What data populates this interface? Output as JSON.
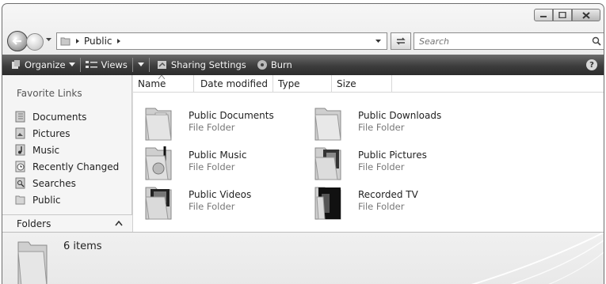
{
  "address": {
    "crumbs": [
      "Public"
    ],
    "search_placeholder": "Search"
  },
  "toolbar": {
    "organize": "Organize",
    "views": "Views",
    "sharing": "Sharing Settings",
    "burn": "Burn",
    "help": "?"
  },
  "nav": {
    "heading": "Favorite Links",
    "items": [
      {
        "label": "Documents",
        "icon": "documents-icon"
      },
      {
        "label": "Pictures",
        "icon": "pictures-icon"
      },
      {
        "label": "Music",
        "icon": "music-icon"
      },
      {
        "label": "Recently Changed",
        "icon": "recently-changed-icon"
      },
      {
        "label": "Searches",
        "icon": "searches-icon"
      },
      {
        "label": "Public",
        "icon": "public-folder-icon"
      }
    ],
    "folders_label": "Folders"
  },
  "columns": [
    "Name",
    "Date modified",
    "Type",
    "Size"
  ],
  "items": [
    {
      "name": "Public Documents",
      "type": "File Folder",
      "icon": "documents-folder-icon"
    },
    {
      "name": "Public Downloads",
      "type": "File Folder",
      "icon": "downloads-folder-icon"
    },
    {
      "name": "Public Music",
      "type": "File Folder",
      "icon": "music-folder-icon"
    },
    {
      "name": "Public Pictures",
      "type": "File Folder",
      "icon": "pictures-folder-icon"
    },
    {
      "name": "Public Videos",
      "type": "File Folder",
      "icon": "videos-folder-icon"
    },
    {
      "name": "Recorded TV",
      "type": "File Folder",
      "icon": "recorded-tv-folder-icon"
    }
  ],
  "details": {
    "count": "6 items"
  }
}
